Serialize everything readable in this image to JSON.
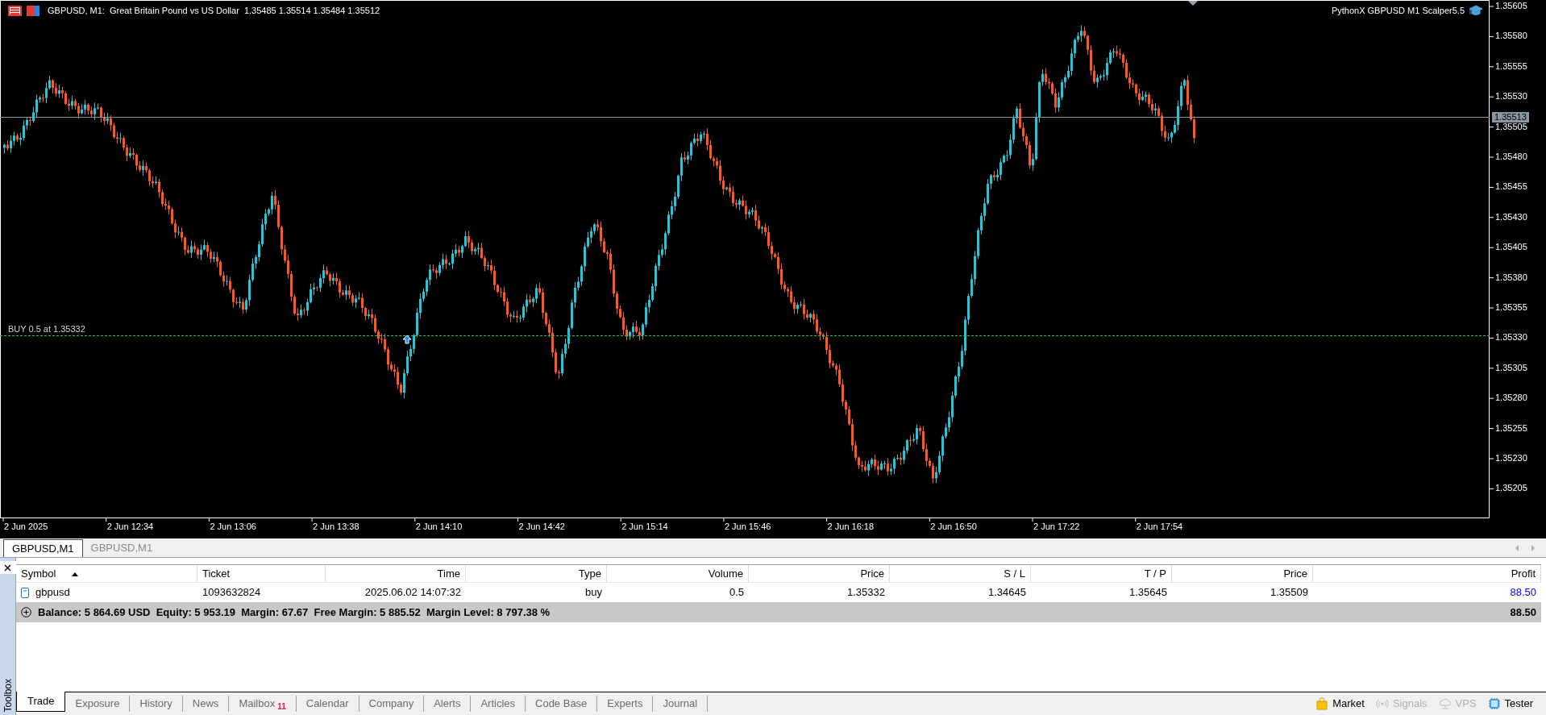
{
  "chart": {
    "title": "GBPUSD, M1:  Great Britain Pound vs US Dollar  1.35485 1.35514 1.35484 1.35512",
    "expert": "PythonX GBPUSD M1 Scalper5.5",
    "price_ticks": [
      "1.35605",
      "1.35580",
      "1.35555",
      "1.35530",
      "1.35505",
      "1.35480",
      "1.35455",
      "1.35430",
      "1.35405",
      "1.35380",
      "1.35355",
      "1.35330",
      "1.35305",
      "1.35280",
      "1.35255",
      "1.35230",
      "1.35205"
    ],
    "bid_label": "1.35513",
    "trade_line_label": "BUY 0.5 at 1.35332",
    "time_ticks": [
      "2 Jun 2025",
      "2 Jun 12:34",
      "2 Jun 13:06",
      "2 Jun 13:38",
      "2 Jun 14:10",
      "2 Jun 14:42",
      "2 Jun 15:14",
      "2 Jun 15:46",
      "2 Jun 16:18",
      "2 Jun 16:50",
      "2 Jun 17:22",
      "2 Jun 17:54"
    ]
  },
  "chart_tabs": [
    {
      "label": "GBPUSD,M1",
      "selected": true
    },
    {
      "label": "GBPUSD,M1",
      "selected": false
    }
  ],
  "toolbox": {
    "side_label": "Toolbox",
    "columns": [
      {
        "label": "Symbol",
        "sorted": true
      },
      {
        "label": "Ticket",
        "sorted": false
      },
      {
        "label": "Time",
        "sorted": false
      },
      {
        "label": "Type",
        "sorted": false
      },
      {
        "label": "Volume",
        "sorted": false
      },
      {
        "label": "Price",
        "sorted": false
      },
      {
        "label": "S / L",
        "sorted": false
      },
      {
        "label": "T / P",
        "sorted": false
      },
      {
        "label": "Price",
        "sorted": false
      },
      {
        "label": "Profit",
        "sorted": false
      }
    ],
    "rows": [
      {
        "cells": [
          "gbpusd",
          "1093632824",
          "2025.06.02 14:07:32",
          "buy",
          "0.5",
          "1.35332",
          "1.34645",
          "1.35645",
          "1.35509",
          "88.50"
        ]
      }
    ],
    "summary": {
      "text": "Balance: 5 864.69 USD  Equity: 5 953.19  Margin: 67.67  Free Margin: 5 885.52  Margin Level: 8 797.38 %",
      "profit": "88.50"
    },
    "tabs": [
      {
        "label": "Trade",
        "selected": true
      },
      {
        "label": "Exposure",
        "selected": false
      },
      {
        "label": "History",
        "selected": false
      },
      {
        "label": "News",
        "selected": false
      },
      {
        "label": "Mailbox",
        "selected": false,
        "badge": "11"
      },
      {
        "label": "Calendar",
        "selected": false
      },
      {
        "label": "Company",
        "selected": false
      },
      {
        "label": "Alerts",
        "selected": false
      },
      {
        "label": "Articles",
        "selected": false
      },
      {
        "label": "Code Base",
        "selected": false
      },
      {
        "label": "Experts",
        "selected": false
      },
      {
        "label": "Journal",
        "selected": false
      }
    ],
    "links": [
      {
        "kind": "market",
        "label": "Market",
        "disabled": false
      },
      {
        "kind": "signals",
        "label": "Signals",
        "disabled": true
      },
      {
        "kind": "vps",
        "label": "VPS",
        "disabled": true
      },
      {
        "kind": "tester",
        "label": "Tester",
        "disabled": false
      }
    ]
  }
}
